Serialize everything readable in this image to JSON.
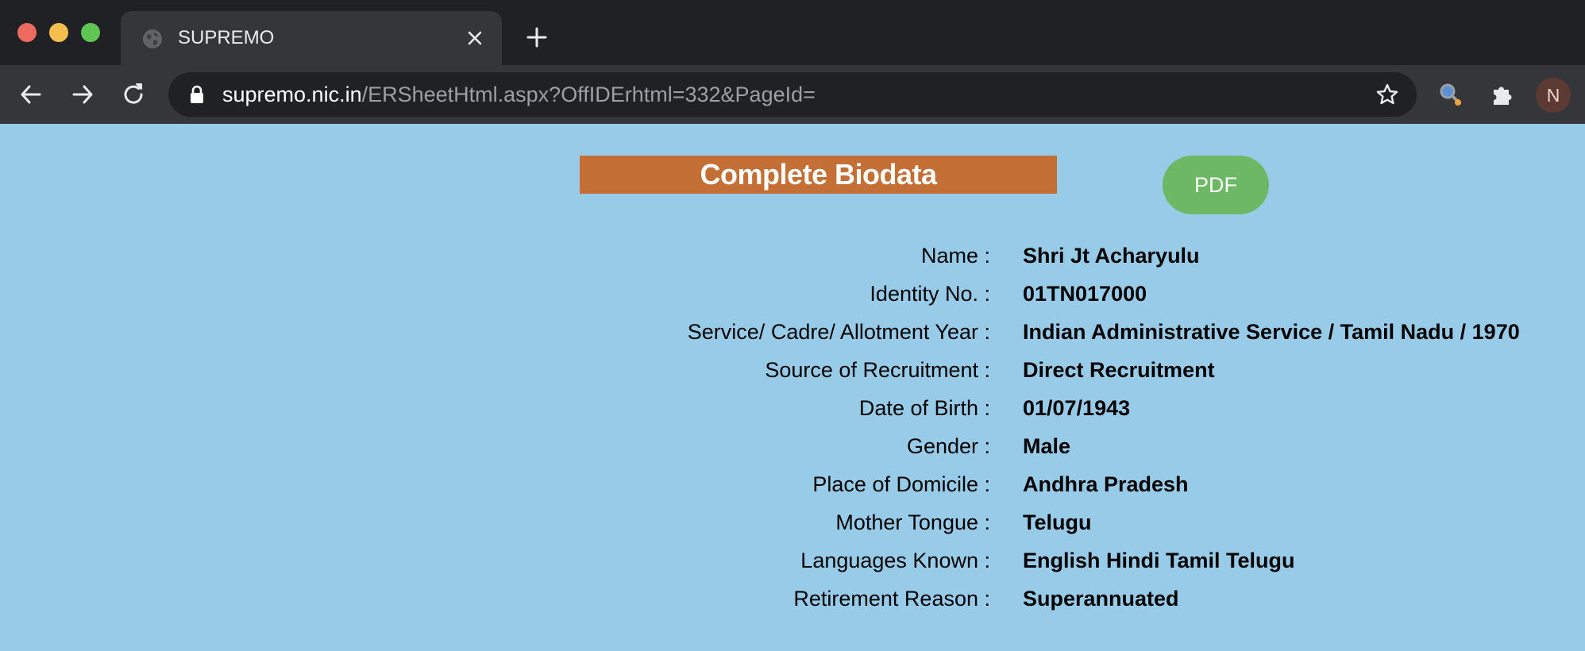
{
  "browser": {
    "tab": {
      "title": "SUPREMO"
    },
    "url": {
      "host": "supremo.nic.in",
      "path": "/ERSheetHtml.aspx?OffIDErhtml=332&PageId="
    },
    "profile_initial": "N",
    "icons": {
      "favicon": "globe-icon",
      "close": "close-icon",
      "new_tab": "plus-icon",
      "back": "back-arrow-icon",
      "forward": "forward-arrow-icon",
      "reload": "reload-icon",
      "lock": "lock-icon",
      "bookmark": "star-icon",
      "extension_1": "magnifier-extension-icon",
      "extension_2": "puzzle-extension-icon"
    }
  },
  "page": {
    "heading": "Complete Biodata",
    "pdf_label": "PDF",
    "colors": {
      "background": "#97cbe8",
      "banner": "#c46f35",
      "pdf_button": "#6cb865"
    },
    "rows": [
      {
        "label": "Name :",
        "value": "Shri Jt Acharyulu"
      },
      {
        "label": "Identity No. :",
        "value": "01TN017000"
      },
      {
        "label": "Service/ Cadre/ Allotment Year :",
        "value": "Indian Administrative Service / Tamil Nadu / 1970"
      },
      {
        "label": "Source of Recruitment :",
        "value": "Direct Recruitment"
      },
      {
        "label": "Date of Birth :",
        "value": "01/07/1943"
      },
      {
        "label": "Gender :",
        "value": "Male"
      },
      {
        "label": "Place of Domicile :",
        "value": "Andhra Pradesh"
      },
      {
        "label": "Mother Tongue :",
        "value": "Telugu"
      },
      {
        "label": "Languages Known :",
        "value": "English Hindi Tamil Telugu"
      },
      {
        "label": "Retirement Reason :",
        "value": "Superannuated"
      }
    ]
  }
}
